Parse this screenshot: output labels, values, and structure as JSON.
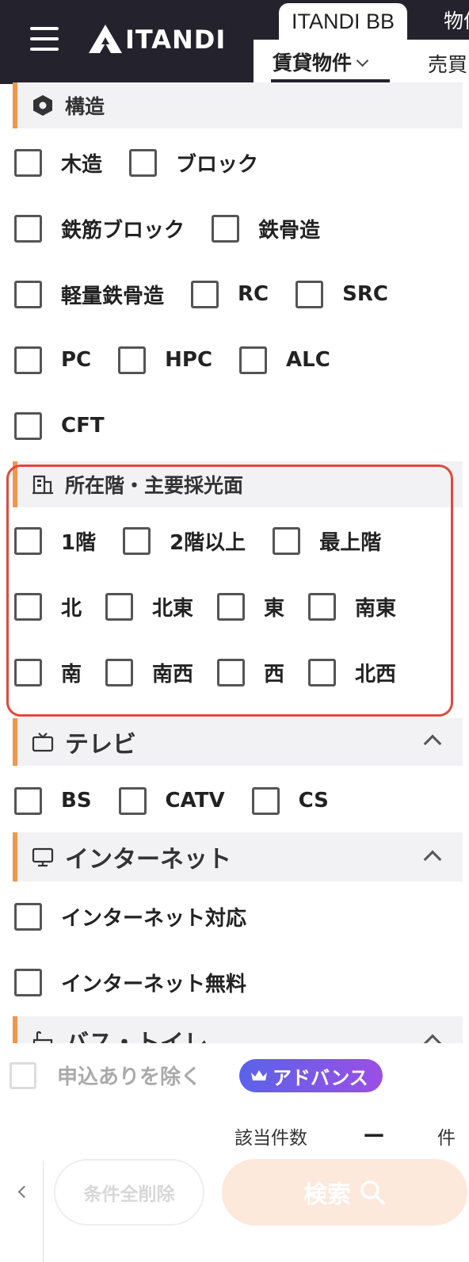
{
  "header": {
    "logo_text": "ITANDI",
    "tabs": [
      "ITANDI BB",
      "物件"
    ],
    "nav": {
      "rent_label": "賃貸物件",
      "sale_label": "売買"
    }
  },
  "sections": {
    "structure": {
      "title": "構造",
      "options": [
        "木造",
        "ブロック",
        "鉄筋ブロック",
        "鉄骨造",
        "軽量鉄骨造",
        "RC",
        "SRC",
        "PC",
        "HPC",
        "ALC",
        "CFT"
      ]
    },
    "floor": {
      "title": "所在階・主要採光面",
      "options": [
        "1階",
        "2階以上",
        "最上階",
        "北",
        "北東",
        "東",
        "南東",
        "南",
        "南西",
        "西",
        "北西"
      ]
    },
    "tv": {
      "title": "テレビ",
      "options": [
        "BS",
        "CATV",
        "CS"
      ]
    },
    "internet": {
      "title": "インターネット",
      "options": [
        "インターネット対応",
        "インターネット無料"
      ]
    },
    "bath": {
      "title": "バス・トイレ"
    }
  },
  "bottom": {
    "exclude_label": "申込ありを除く",
    "badge_label": "アドバンス",
    "count_label": "該当件数",
    "count_value": "ー",
    "count_unit": "件",
    "clear_label": "条件全削除",
    "search_label": "検索"
  },
  "colors": {
    "header_bg": "#24222c",
    "section_accent": "#f0964d",
    "highlight": "#e04a3a",
    "search_bg": "#fde8dc"
  }
}
